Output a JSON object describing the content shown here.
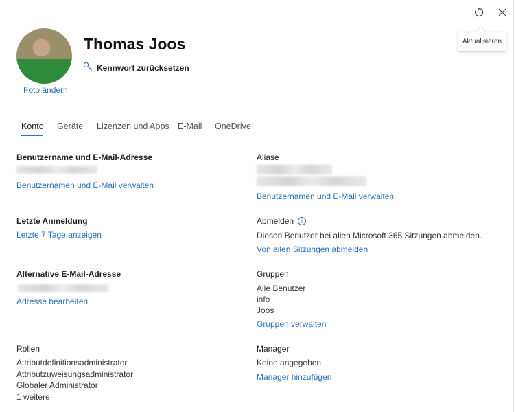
{
  "header": {
    "refresh_tooltip": "Aktualisieren",
    "name": "Thomas Joos",
    "reset_password": "Kennwort zurücksetzen",
    "change_photo": "Foto ändern"
  },
  "tabs": [
    "Konto",
    "Geräte",
    "Lizenzen und Apps",
    "E-Mail",
    "OneDrive"
  ],
  "left": {
    "username": {
      "title": "Benutzername und E-Mail-Adresse",
      "link": "Benutzernamen und E-Mail verwalten"
    },
    "last_login": {
      "title": "Letzte Anmeldung",
      "link": "Letzte 7 Tage anzeigen"
    },
    "alt_email": {
      "title": "Alternative E-Mail-Adresse",
      "link": "Adresse bearbeiten"
    },
    "roles": {
      "title": "Rollen",
      "items": [
        "Attributdefinitionsadministrator",
        "Attributzuweisungsadministrator",
        "Globaler Administrator",
        "1 weitere"
      ]
    }
  },
  "right": {
    "aliases": {
      "title": "Aliase",
      "link": "Benutzernamen und E-Mail verwalten"
    },
    "signout": {
      "title": "Abmelden",
      "text": "Diesen Benutzer bei allen Microsoft 365 Sitzungen abmelden.",
      "link": "Von allen Sitzungen abmelden"
    },
    "groups": {
      "title": "Gruppen",
      "items": [
        "Alle Benutzer",
        "info",
        "Joos"
      ],
      "link": "Gruppen verwalten"
    },
    "manager": {
      "title": "Manager",
      "text": "Keine angegeben",
      "link": "Manager hinzufügen"
    }
  },
  "colors": {
    "accent": "#2c74b8"
  }
}
